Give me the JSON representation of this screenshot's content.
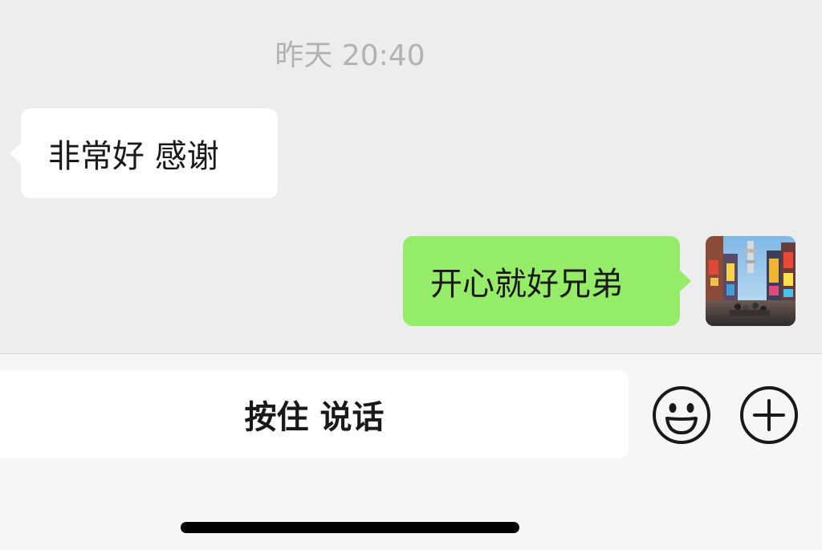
{
  "chat": {
    "timestamp": "昨天 20:40",
    "messages": [
      {
        "direction": "incoming",
        "text": "非常好 感谢",
        "bubble_color": "#ffffff"
      },
      {
        "direction": "outgoing",
        "text": "开心就好兄弟",
        "bubble_color": "#95ec69",
        "avatar": "city-street-photo"
      }
    ]
  },
  "input_bar": {
    "voice_label": "按住 说话",
    "emoji_icon": "smiley-face-icon",
    "plus_icon": "circle-plus-icon"
  },
  "colors": {
    "chat_background": "#ededed",
    "input_background": "#f6f6f6",
    "outgoing_bubble": "#95ec69",
    "timestamp_text": "#b2b2b2"
  }
}
